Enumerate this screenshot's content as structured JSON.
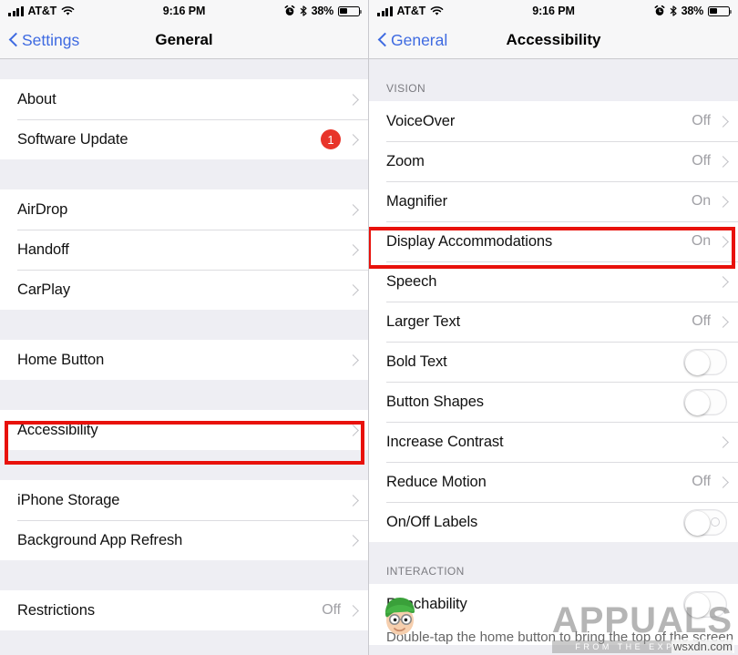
{
  "status_bar": {
    "carrier": "AT&T",
    "time": "9:16 PM",
    "battery_percent": "38%",
    "signal_icon": "signal-bars-icon",
    "wifi_icon": "wifi-icon",
    "alarm_icon": "alarm-clock-icon",
    "bluetooth_icon": "bluetooth-icon",
    "battery_icon": "battery-icon"
  },
  "left_screen": {
    "nav": {
      "back_label": "Settings",
      "title": "General"
    },
    "sections": [
      {
        "header": "",
        "rows": [
          {
            "label": "About",
            "value": "",
            "accessory": "chevron"
          },
          {
            "label": "Software Update",
            "value": "",
            "badge": "1",
            "accessory": "chevron"
          }
        ]
      },
      {
        "header": "",
        "rows": [
          {
            "label": "AirDrop",
            "value": "",
            "accessory": "chevron"
          },
          {
            "label": "Handoff",
            "value": "",
            "accessory": "chevron"
          },
          {
            "label": "CarPlay",
            "value": "",
            "accessory": "chevron"
          }
        ]
      },
      {
        "header": "",
        "rows": [
          {
            "label": "Home Button",
            "value": "",
            "accessory": "chevron"
          }
        ]
      },
      {
        "header": "",
        "rows": [
          {
            "label": "Accessibility",
            "value": "",
            "accessory": "chevron",
            "highlighted": true
          }
        ]
      },
      {
        "header": "",
        "rows": [
          {
            "label": "iPhone Storage",
            "value": "",
            "accessory": "chevron"
          },
          {
            "label": "Background App Refresh",
            "value": "",
            "accessory": "chevron"
          }
        ]
      },
      {
        "header": "",
        "rows": [
          {
            "label": "Restrictions",
            "value": "Off",
            "accessory": "chevron"
          }
        ]
      }
    ]
  },
  "right_screen": {
    "nav": {
      "back_label": "General",
      "title": "Accessibility"
    },
    "sections": [
      {
        "header": "VISION",
        "rows": [
          {
            "label": "VoiceOver",
            "value": "Off",
            "accessory": "chevron"
          },
          {
            "label": "Zoom",
            "value": "Off",
            "accessory": "chevron"
          },
          {
            "label": "Magnifier",
            "value": "On",
            "accessory": "chevron"
          },
          {
            "label": "Display Accommodations",
            "value": "On",
            "accessory": "chevron",
            "highlighted": true
          },
          {
            "label": "Speech",
            "value": "",
            "accessory": "chevron"
          },
          {
            "label": "Larger Text",
            "value": "Off",
            "accessory": "chevron"
          },
          {
            "label": "Bold Text",
            "value": "",
            "accessory": "toggle",
            "toggle_on": false
          },
          {
            "label": "Button Shapes",
            "value": "",
            "accessory": "toggle",
            "toggle_on": false
          },
          {
            "label": "Increase Contrast",
            "value": "",
            "accessory": "chevron"
          },
          {
            "label": "Reduce Motion",
            "value": "Off",
            "accessory": "chevron"
          },
          {
            "label": "On/Off Labels",
            "value": "",
            "accessory": "toggle-labeled",
            "toggle_on": false
          }
        ]
      },
      {
        "header": "INTERACTION",
        "rows": [
          {
            "label": "Reachability",
            "value": "",
            "accessory": "toggle",
            "toggle_on": false
          }
        ]
      }
    ],
    "footer_note": "Double-tap the home button to bring the top of the screen"
  },
  "watermark": {
    "brand": "APPUALS",
    "tagline": "FROM THE EXPERTS",
    "site": "wsxdn.com"
  },
  "colors": {
    "accent_blue": "#3e6ae1",
    "highlight_red": "#e8110b",
    "badge_red": "#e8342a",
    "group_bg": "#eeeef3"
  }
}
